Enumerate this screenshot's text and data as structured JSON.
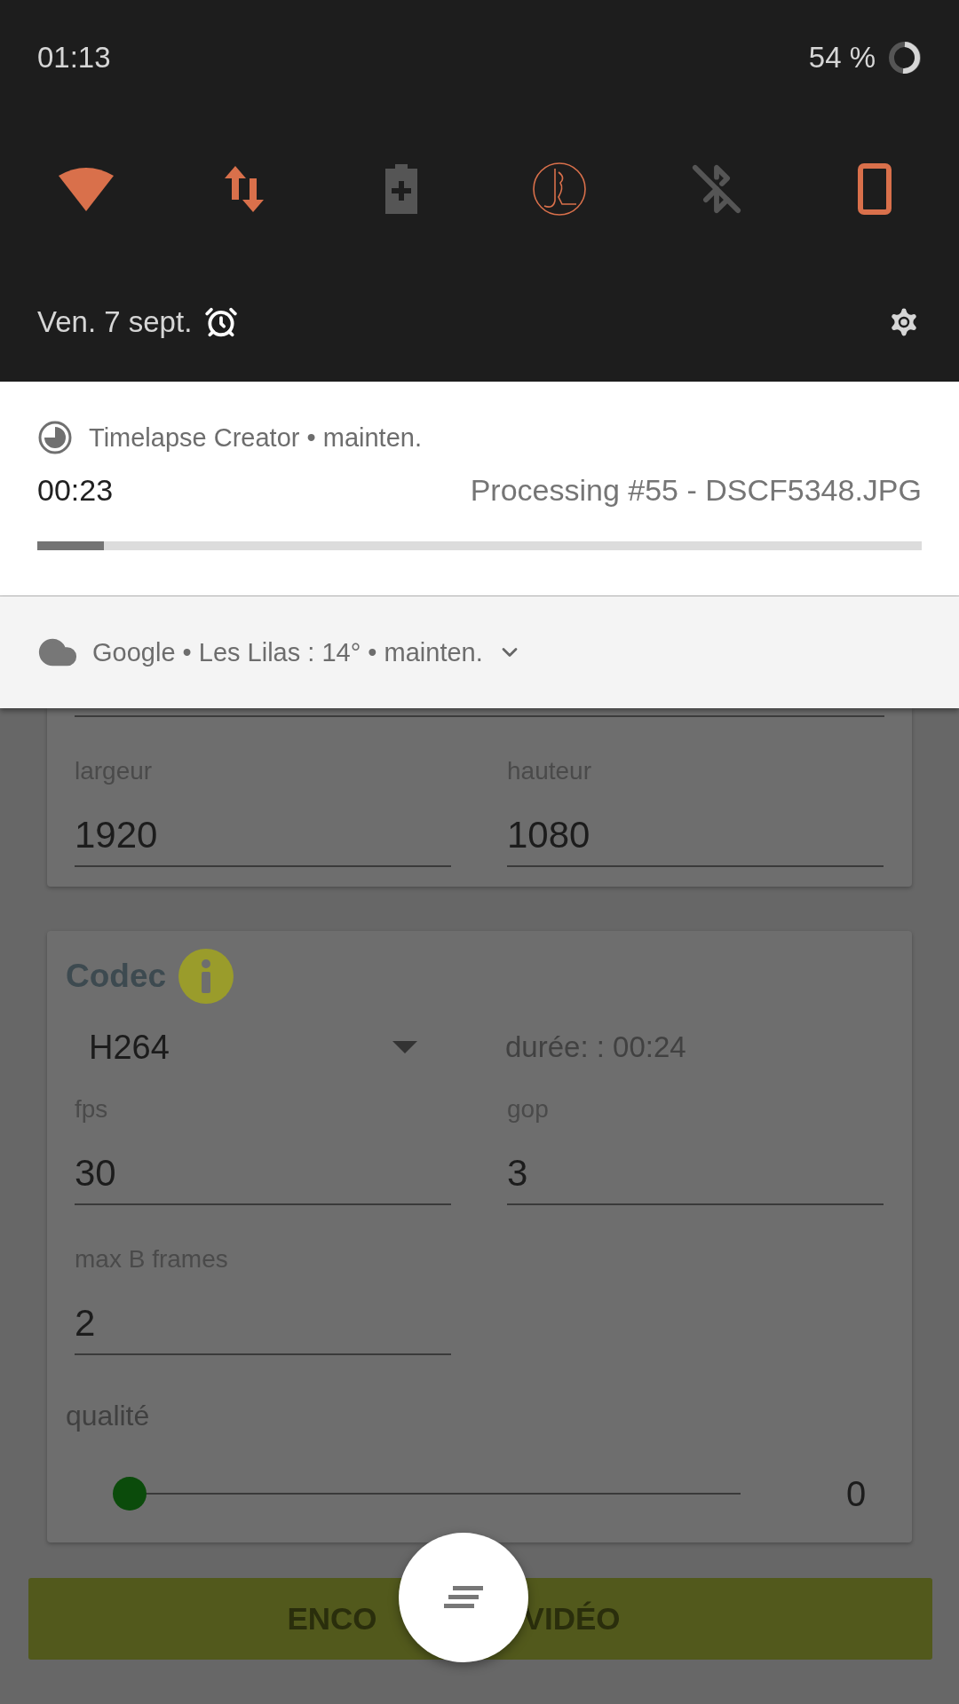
{
  "status_bar": {
    "time": "01:13",
    "battery": "54 %"
  },
  "quick_tiles": [
    {
      "kind": "wifi",
      "on": true
    },
    {
      "kind": "data",
      "on": true
    },
    {
      "kind": "battery_saver",
      "on": false
    },
    {
      "kind": "custom",
      "on": true
    },
    {
      "kind": "bluetooth",
      "on": false
    },
    {
      "kind": "rotation",
      "on": true
    }
  ],
  "date": "Ven. 7 sept.",
  "notifications": [
    {
      "kind": "progress",
      "app": "Timelapse Creator • mainten.",
      "title": "00:23",
      "text": "Processing #55 - DSCF5348.JPG",
      "level": 0.075
    },
    {
      "kind": "weather",
      "text": "Google • Les Lilas : 14° • mainten."
    }
  ],
  "app": {
    "resolution": {
      "fields": [
        {
          "label": "largeur",
          "value": "1920"
        },
        {
          "label": "hauteur",
          "value": "1080"
        }
      ]
    },
    "codec": {
      "title": "Codec",
      "codec_value": "H264",
      "duration": "durée: : 00:24",
      "fields": [
        {
          "label": "fps",
          "value": "30"
        },
        {
          "label": "gop",
          "value": "3"
        },
        {
          "label": "max B frames",
          "value": "2"
        }
      ],
      "quality": {
        "label": "qualité",
        "level": 0,
        "value": "0"
      }
    },
    "encode_button": [
      "ENCO",
      "VIDÉO"
    ]
  }
}
